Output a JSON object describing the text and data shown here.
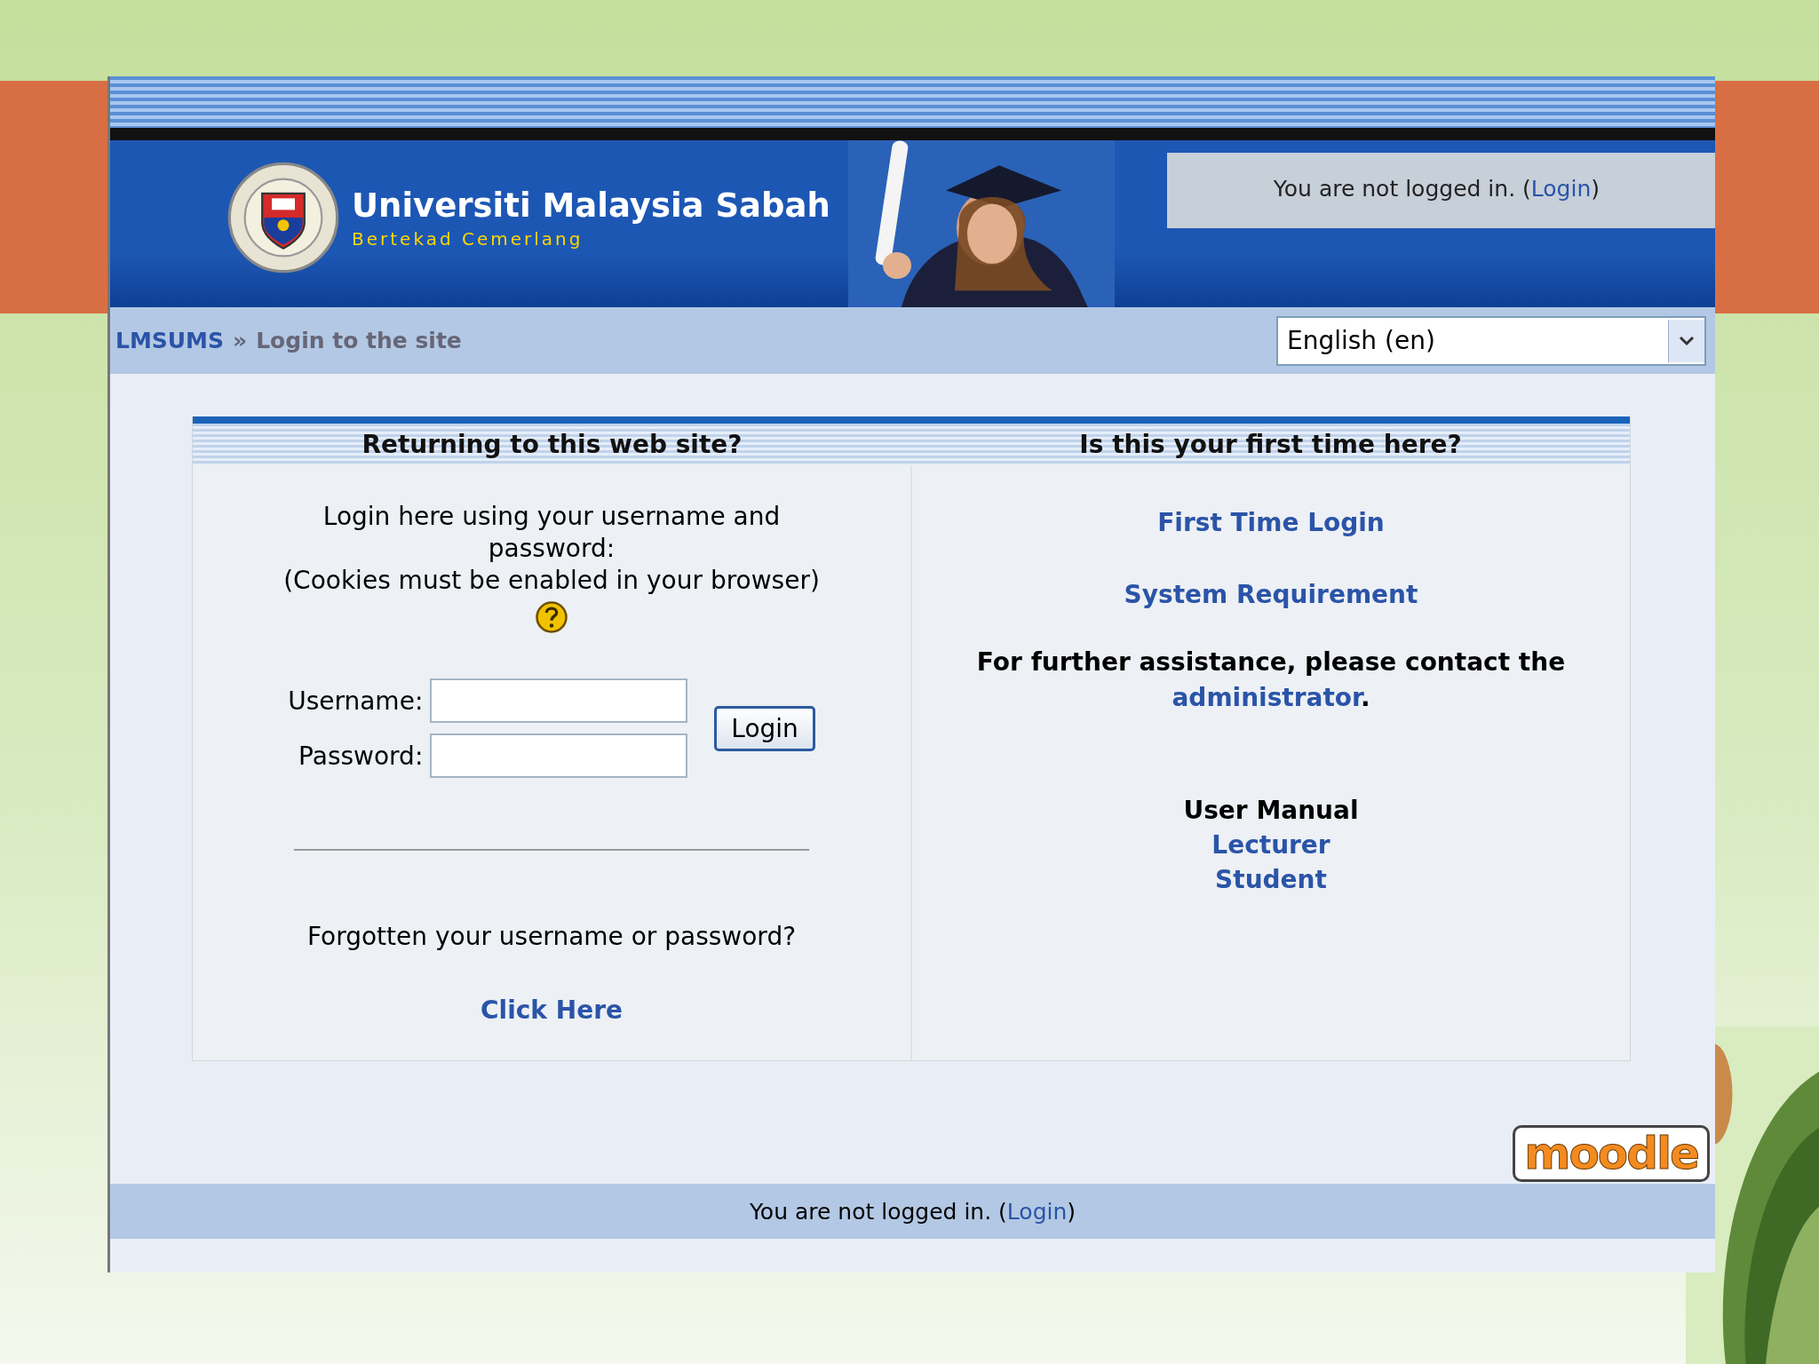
{
  "header": {
    "title": "Universiti Malaysia Sabah",
    "motto": "Bertekad Cemerlang",
    "login_info": {
      "text": "You are not logged in. (",
      "link": "Login",
      "close": ")"
    }
  },
  "navbar": {
    "home": "LMSUMS",
    "separator": "»",
    "current": "Login to the site",
    "language": "English (en)"
  },
  "login_box": {
    "returning": {
      "heading": "Returning to this web site?",
      "intro": [
        "Login here using your username and password:",
        "(Cookies must be enabled in your browser)"
      ],
      "username_label": "Username:",
      "password_label": "Password:",
      "button": "Login",
      "forgotten": "Forgotten your username or password?",
      "forgotten_link": "Click Here"
    },
    "first_time": {
      "heading": "Is this your first time here?",
      "links": [
        "First Time Login",
        "System Requirement"
      ],
      "assistance": "For further assistance, please contact the",
      "assistance_link": "administrator",
      "assistance_end": ".",
      "manual_heading": "User Manual",
      "manual_links": [
        "Lecturer",
        "Student"
      ]
    }
  },
  "logo": "moodle",
  "footer": {
    "text": "You are not logged in. (",
    "link": "Login",
    "close": ")"
  }
}
